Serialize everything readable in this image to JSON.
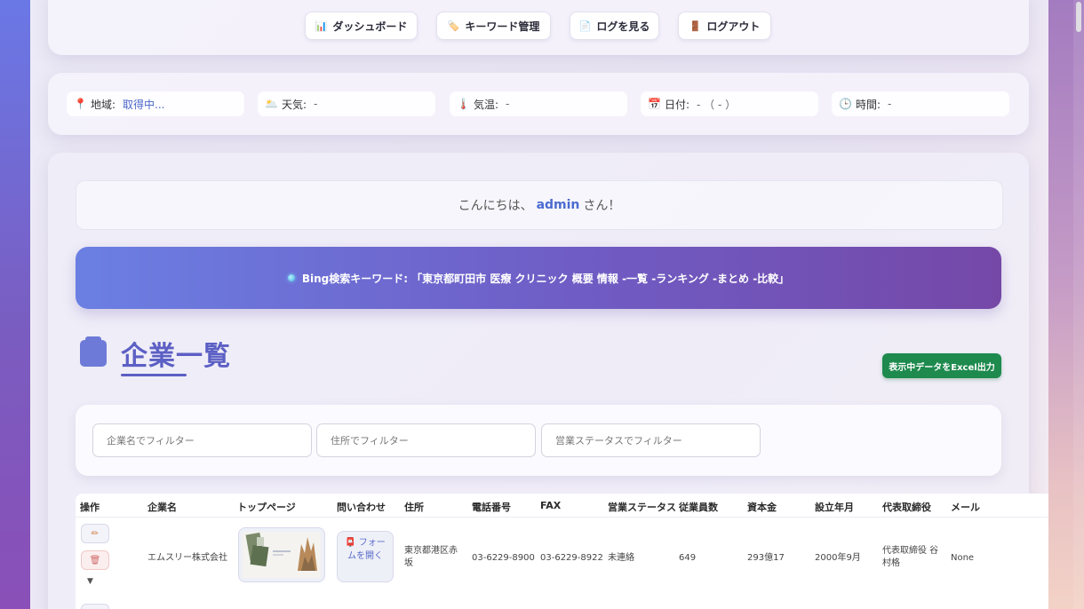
{
  "nav": {
    "dashboard": {
      "icon": "📊",
      "label": "ダッシュボード"
    },
    "keywords": {
      "icon": "🏷️",
      "label": "キーワード管理"
    },
    "logs": {
      "icon": "📄",
      "label": "ログを見る"
    },
    "logout": {
      "icon": "🚪",
      "label": "ログアウト"
    }
  },
  "info": {
    "region": {
      "icon": "📍",
      "label": "地域:",
      "value": "取得中..."
    },
    "weather": {
      "icon": "🌥️",
      "label": "天気:",
      "value": "-"
    },
    "temp": {
      "icon": "🌡️",
      "label": "気温:",
      "value": "-"
    },
    "date": {
      "icon": "📅",
      "label": "日付:",
      "value": "- （ - ）"
    },
    "time": {
      "icon": "🕒",
      "label": "時間:",
      "value": "-"
    }
  },
  "greeting": {
    "prefix": "こんにちは、",
    "user": "admin",
    "suffix": "さん！"
  },
  "keyword_banner": "Bing検索キーワード: 「東京都町田市 医療 クリニック 概要 情報 -一覧 -ランキング -まとめ -比較」",
  "page_title": "企業一覧",
  "excel_button": "表示中データをExcel出力",
  "filters": {
    "company": "企業名でフィルター",
    "address": "住所でフィルター",
    "status": "営業ステータスでフィルター"
  },
  "table": {
    "headers": [
      "操作",
      "企業名",
      "トップページ",
      "問い合わせ",
      "住所",
      "電話番号",
      "FAX",
      "営業ステータス",
      "従業員数",
      "資本金",
      "設立年月",
      "代表取締役",
      "メール"
    ],
    "rows": [
      {
        "company": "エムスリー株式会社",
        "contact": "📮 フォームを開く",
        "address": "東京都港区赤坂",
        "phone": "03-6229-8900",
        "fax": "03-6229-8922",
        "status": "未連絡",
        "employees": "649",
        "capital": "293億17",
        "founded": "2000年9月",
        "ceo": "代表取締役 谷村格",
        "email": "None"
      }
    ]
  },
  "colors": {
    "accent": "#5c5fc4",
    "excel": "#1e8a4e",
    "banner_start": "#6b7fe3",
    "banner_end": "#7548a8"
  }
}
